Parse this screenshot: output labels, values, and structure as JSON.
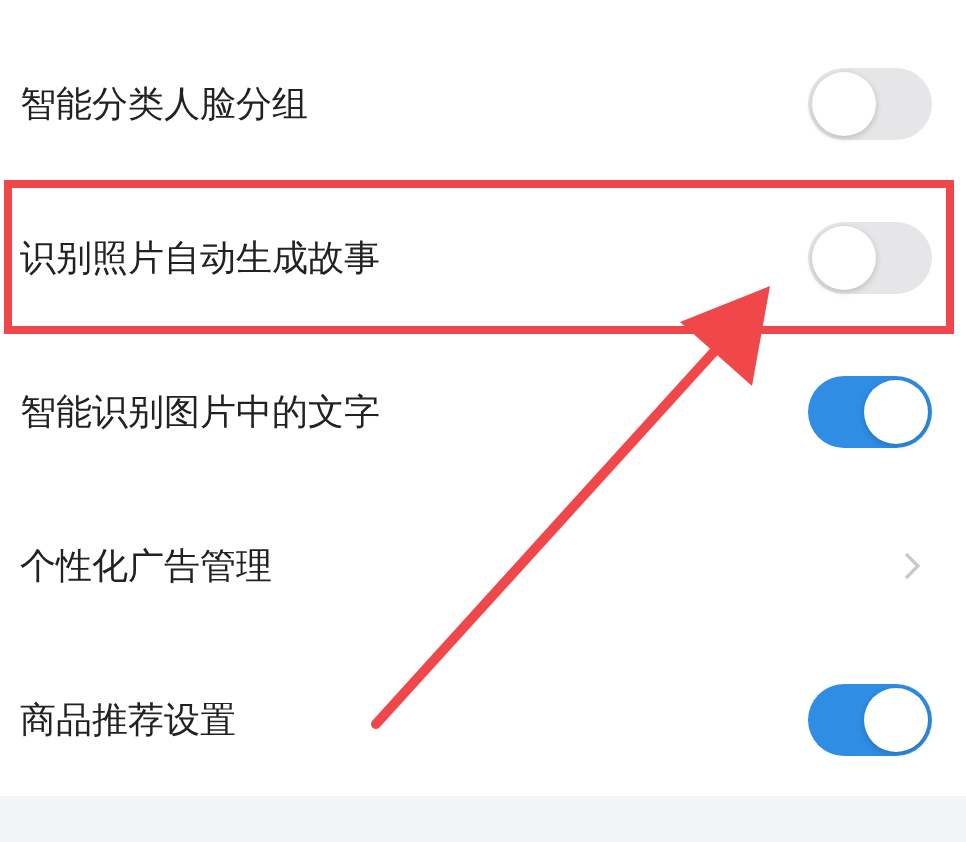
{
  "settings": [
    {
      "label": "智能分类人脸分组",
      "kind": "toggle",
      "on": false,
      "highlighted": false
    },
    {
      "label": "识别照片自动生成故事",
      "kind": "toggle",
      "on": false,
      "highlighted": true
    },
    {
      "label": "智能识别图片中的文字",
      "kind": "toggle",
      "on": true,
      "highlighted": false
    },
    {
      "label": "个性化广告管理",
      "kind": "link",
      "highlighted": false
    },
    {
      "label": "商品推荐设置",
      "kind": "toggle",
      "on": true,
      "highlighted": false
    }
  ]
}
